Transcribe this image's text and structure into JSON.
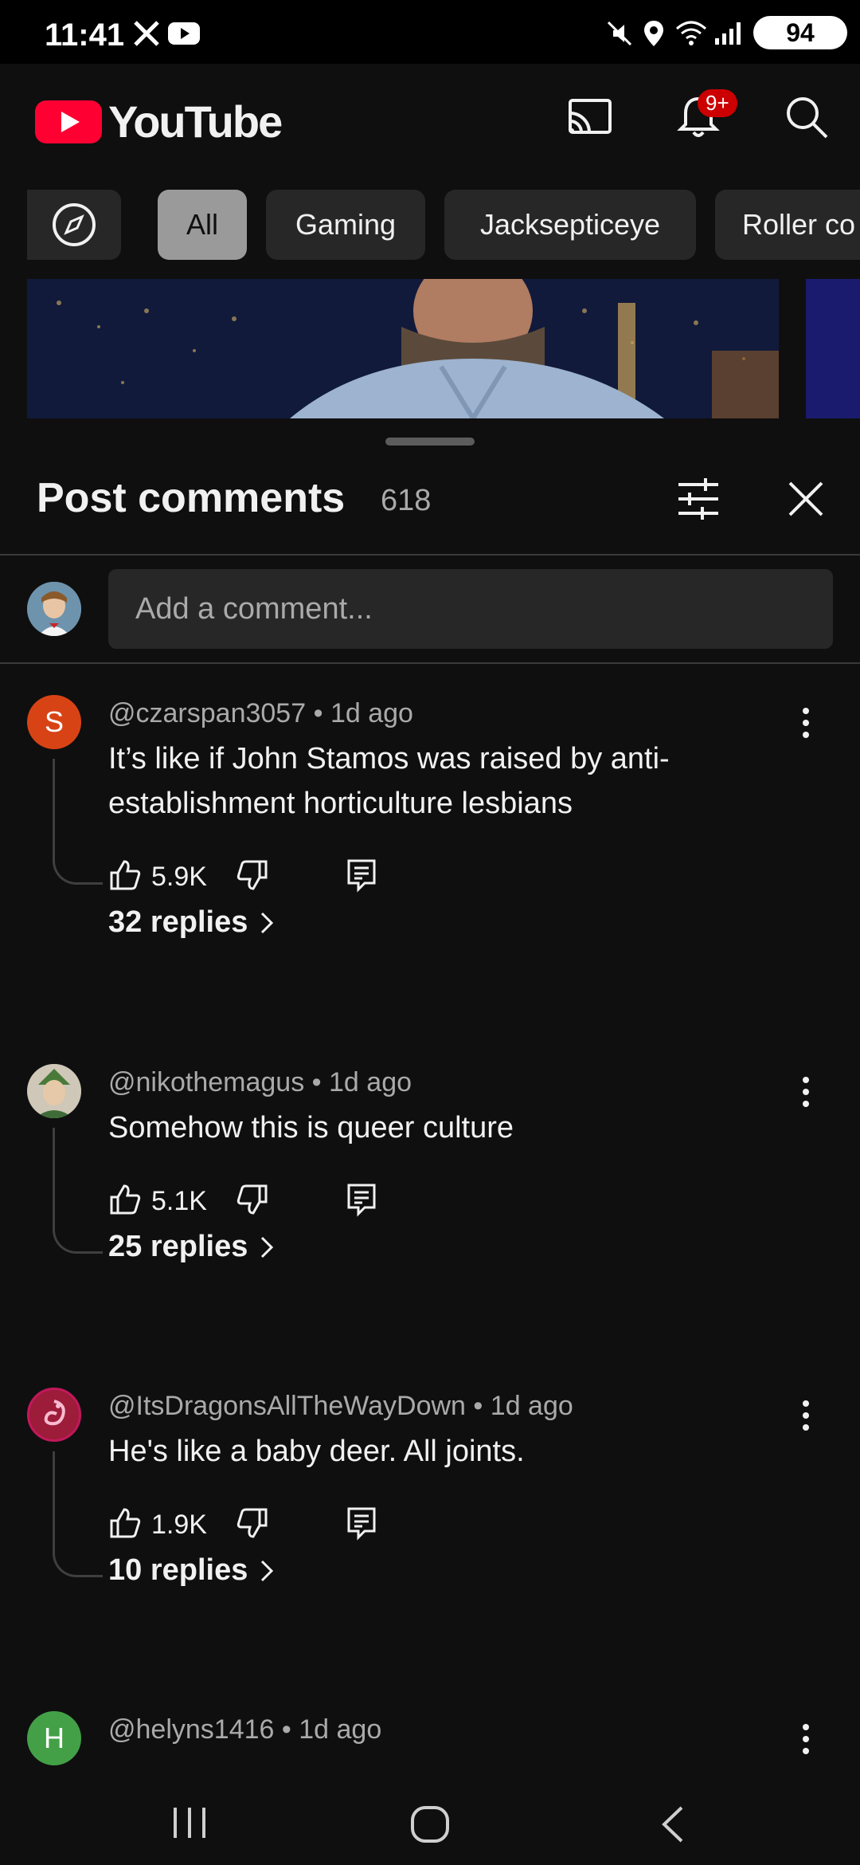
{
  "status_bar": {
    "time": "11:41",
    "battery": "94"
  },
  "header": {
    "brand": "YouTube",
    "notif_badge": "9+"
  },
  "chips": [
    {
      "label": "All",
      "active": true
    },
    {
      "label": "Gaming"
    },
    {
      "label": "Jacksepticeye"
    },
    {
      "label": "Roller co"
    }
  ],
  "sheet": {
    "title": "Post comments",
    "count": "618",
    "add_comment_placeholder": "Add a comment..."
  },
  "comments": [
    {
      "author": "@czarspan3057",
      "time": "1d ago",
      "avatar_letter": "S",
      "avatar_color": "#d84315",
      "text": "It’s like if John Stamos was raised by anti-establishment horticulture lesbians",
      "likes": "5.9K",
      "replies": "32 replies"
    },
    {
      "author": "@nikothemagus",
      "time": "1d ago",
      "text": "Somehow this is queer culture",
      "likes": "5.1K",
      "replies": "25 replies"
    },
    {
      "author": "@ItsDragonsAllTheWayDown",
      "time": "1d ago",
      "avatar_color": "#9c1c3a",
      "text": "He's like a baby deer. All joints.",
      "likes": "1.9K",
      "replies": "10 replies"
    },
    {
      "author": "@helyns1416",
      "time": "1d ago",
      "avatar_letter": "H",
      "avatar_color": "#43a047"
    }
  ]
}
